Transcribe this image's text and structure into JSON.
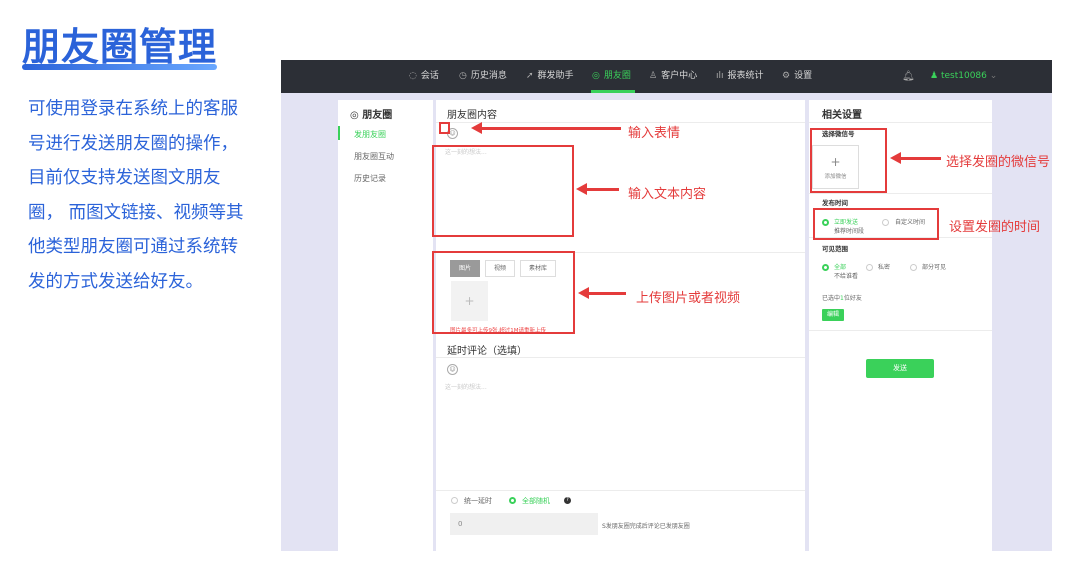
{
  "slide": {
    "title": "朋友圈管理",
    "description": "可使用登录在系统上的客服号进行发送朋友圈的操作，目前仅支持发送图文朋友圈， 而图文链接、视频等其他类型朋友圈可通过系统转发的方式发送给好友。"
  },
  "topnav": {
    "items": [
      {
        "label": "会话",
        "icon": "chat-icon"
      },
      {
        "label": "历史消息",
        "icon": "clock-icon"
      },
      {
        "label": "群发助手",
        "icon": "send-icon"
      },
      {
        "label": "朋友圈",
        "icon": "moments-icon"
      },
      {
        "label": "客户中心",
        "icon": "user-icon"
      },
      {
        "label": "报表统计",
        "icon": "bar-chart-icon"
      },
      {
        "label": "设置",
        "icon": "gear-icon"
      }
    ],
    "active": "朋友圈",
    "user": "test10086",
    "accent": "#3ad15a"
  },
  "sidebar": {
    "title": "朋友圈",
    "items": [
      {
        "label": "发朋友圈",
        "active": true
      },
      {
        "label": "朋友圈互动",
        "active": false
      },
      {
        "label": "历史记录",
        "active": false
      }
    ]
  },
  "main": {
    "header": "朋友圈内容",
    "text_placeholder": "这一刻的想法...",
    "media_tabs": [
      "图片",
      "视频",
      "素材库"
    ],
    "upload_hint": "图片最多可上传9张,超过1M请重新上传",
    "delay_title": "延时评论（选填）",
    "comment_placeholder": "这一刻的想法...",
    "timing_options": [
      "统一延时",
      "全部随机"
    ],
    "delay_value": "0",
    "delay_note": "S发朋友圈完成后评论已发朋友圈"
  },
  "settings": {
    "title": "相关设置",
    "wechat_label": "选择微信号",
    "add_wechat": "添加微信",
    "time_label": "发布时间",
    "time_options": [
      "立即发送",
      "自定义时间",
      "推荐时间段"
    ],
    "visibility_label": "可见范围",
    "visibility_options": [
      "全部",
      "私密",
      "部分可见",
      "不给谁看"
    ],
    "selected_prefix": "已选中",
    "selected_count": "1",
    "selected_suffix": "位好友",
    "edit_button": "编辑",
    "send_button": "发送"
  },
  "annotations": {
    "emoji": "输入表情",
    "text": "输入文本内容",
    "media": "上传图片或者视频",
    "wechat": "选择发圈的微信号",
    "time": "设置发圈的时间",
    "color": "#e43b3b"
  }
}
